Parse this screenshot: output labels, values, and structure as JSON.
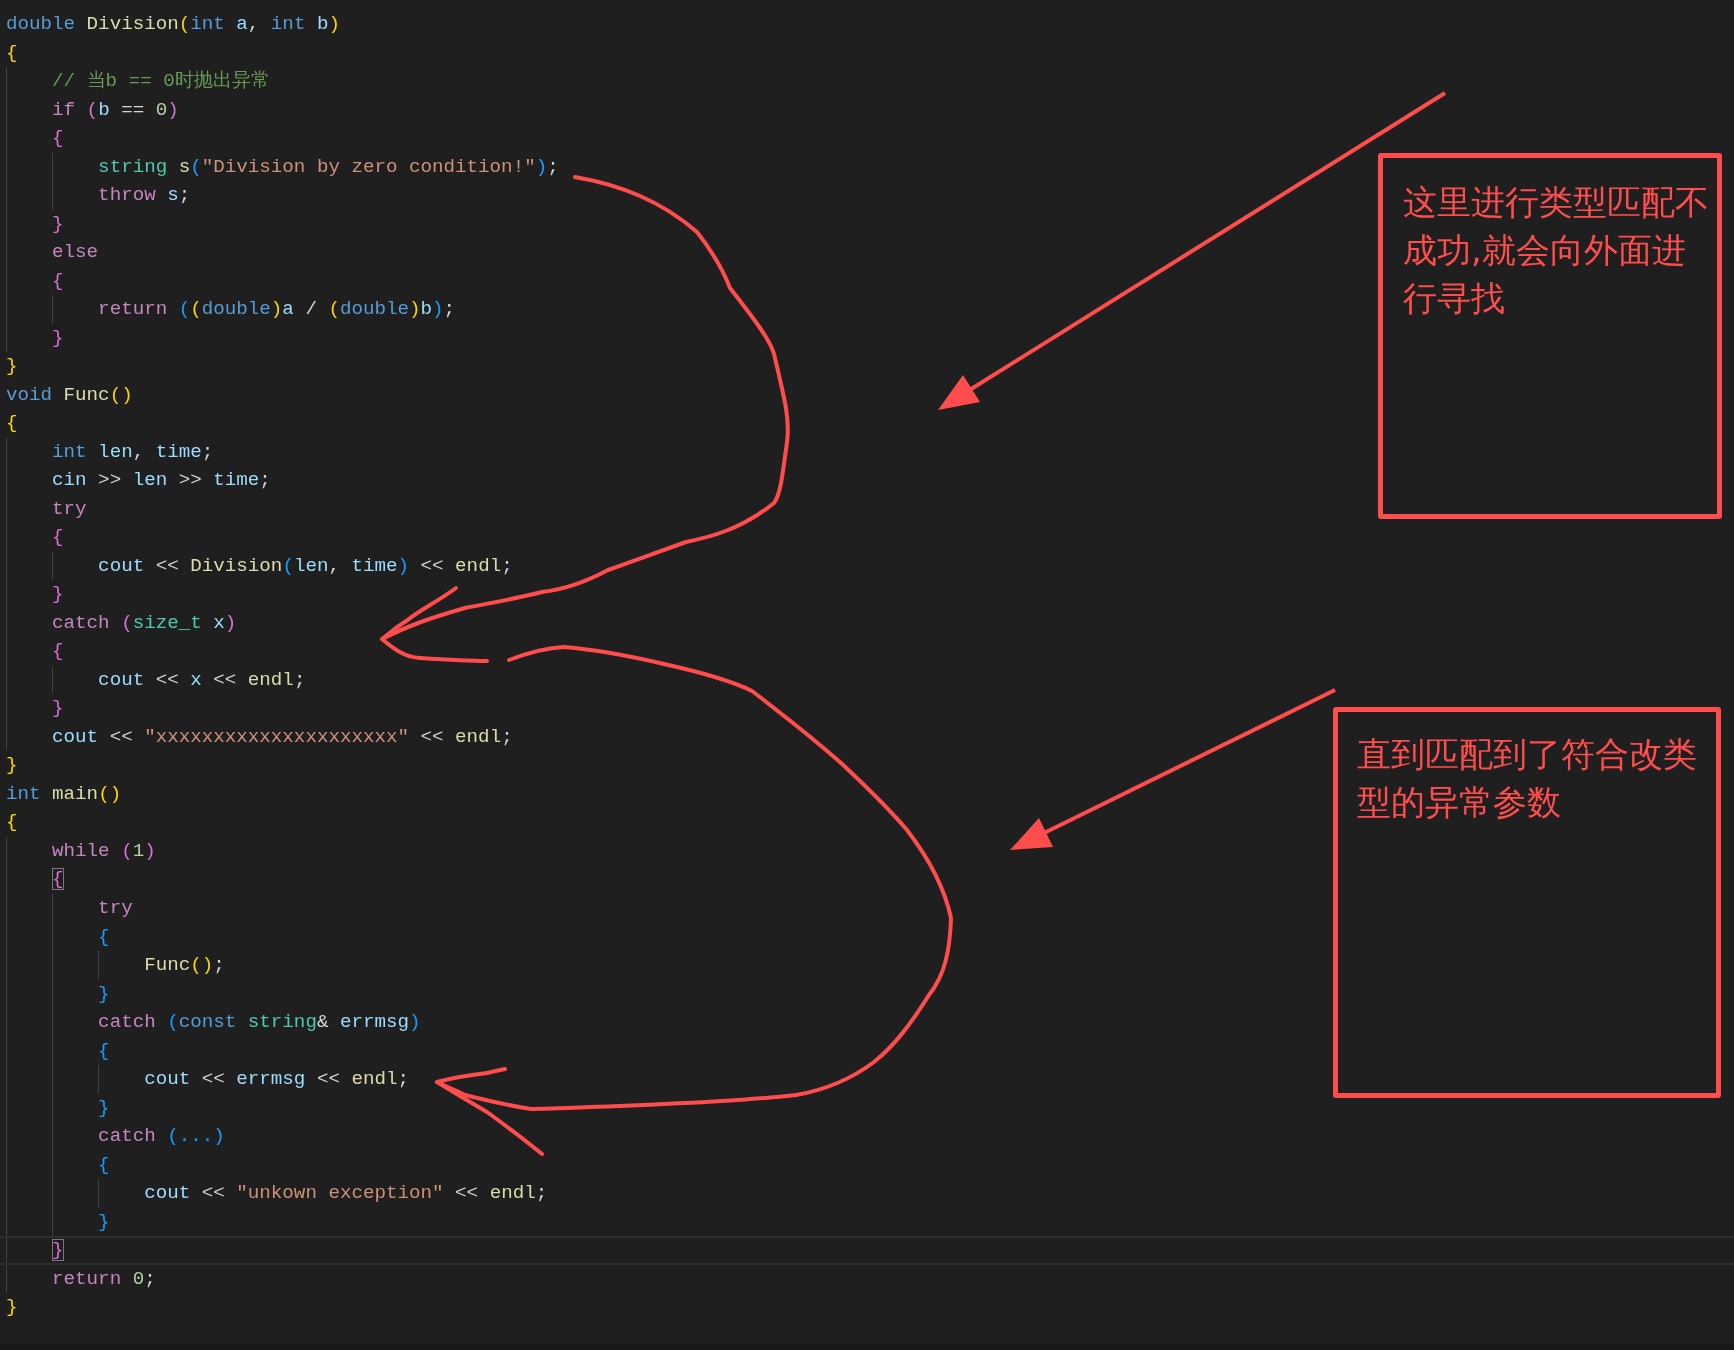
{
  "editor": {
    "lines": [
      {
        "current": false,
        "bracket_match": false,
        "tokens": [
          {
            "text": "double ",
            "kind": "keyword"
          },
          {
            "text": "Division",
            "kind": "function"
          },
          {
            "text": "(",
            "kind": "bracket1"
          },
          {
            "text": "int",
            "kind": "keyword"
          },
          {
            "text": " a",
            "kind": "variable"
          },
          {
            "text": ", ",
            "kind": "plain"
          },
          {
            "text": "int",
            "kind": "keyword"
          },
          {
            "text": " b",
            "kind": "variable"
          },
          {
            "text": ")",
            "kind": "bracket1"
          }
        ]
      },
      {
        "current": false,
        "bracket_match": false,
        "tokens": [
          {
            "text": "{",
            "kind": "bracket1"
          }
        ]
      },
      {
        "current": false,
        "bracket_match": false,
        "tokens": [
          {
            "text": "    // 当b == 0时抛出异常",
            "kind": "comment"
          }
        ]
      },
      {
        "current": false,
        "bracket_match": false,
        "tokens": [
          {
            "text": "    if ",
            "kind": "control"
          },
          {
            "text": "(",
            "kind": "bracket2"
          },
          {
            "text": "b",
            "kind": "variable"
          },
          {
            "text": " == ",
            "kind": "plain"
          },
          {
            "text": "0",
            "kind": "number"
          },
          {
            "text": ")",
            "kind": "bracket2"
          }
        ]
      },
      {
        "current": false,
        "bracket_match": false,
        "tokens": [
          {
            "text": "    {",
            "kind": "bracket2"
          }
        ]
      },
      {
        "current": false,
        "bracket_match": false,
        "tokens": [
          {
            "text": "        string ",
            "kind": "type"
          },
          {
            "text": "s",
            "kind": "function"
          },
          {
            "text": "(",
            "kind": "bracket3"
          },
          {
            "text": "\"Division by zero condition!\"",
            "kind": "string"
          },
          {
            "text": ")",
            "kind": "bracket3"
          },
          {
            "text": ";",
            "kind": "plain"
          }
        ]
      },
      {
        "current": false,
        "bracket_match": false,
        "tokens": [
          {
            "text": "        throw",
            "kind": "control"
          },
          {
            "text": " s",
            "kind": "variable"
          },
          {
            "text": ";",
            "kind": "plain"
          }
        ]
      },
      {
        "current": false,
        "bracket_match": false,
        "tokens": [
          {
            "text": "    }",
            "kind": "bracket2"
          }
        ]
      },
      {
        "current": false,
        "bracket_match": false,
        "tokens": [
          {
            "text": "    else",
            "kind": "control"
          }
        ]
      },
      {
        "current": false,
        "bracket_match": false,
        "tokens": [
          {
            "text": "    {",
            "kind": "bracket2"
          }
        ]
      },
      {
        "current": false,
        "bracket_match": false,
        "tokens": [
          {
            "text": "        return ",
            "kind": "control"
          },
          {
            "text": "(",
            "kind": "bracket3"
          },
          {
            "text": "(",
            "kind": "bracket1"
          },
          {
            "text": "double",
            "kind": "keyword"
          },
          {
            "text": ")",
            "kind": "bracket1"
          },
          {
            "text": "a",
            "kind": "variable"
          },
          {
            "text": " / ",
            "kind": "plain"
          },
          {
            "text": "(",
            "kind": "bracket1"
          },
          {
            "text": "double",
            "kind": "keyword"
          },
          {
            "text": ")",
            "kind": "bracket1"
          },
          {
            "text": "b",
            "kind": "variable"
          },
          {
            "text": ")",
            "kind": "bracket3"
          },
          {
            "text": ";",
            "kind": "plain"
          }
        ]
      },
      {
        "current": false,
        "bracket_match": false,
        "tokens": [
          {
            "text": "    }",
            "kind": "bracket2"
          }
        ]
      },
      {
        "current": false,
        "bracket_match": false,
        "tokens": [
          {
            "text": "}",
            "kind": "bracket1"
          }
        ]
      },
      {
        "current": false,
        "bracket_match": false,
        "tokens": [
          {
            "text": "void ",
            "kind": "keyword"
          },
          {
            "text": "Func",
            "kind": "function"
          },
          {
            "text": "()",
            "kind": "bracket1"
          }
        ]
      },
      {
        "current": false,
        "bracket_match": false,
        "tokens": [
          {
            "text": "{",
            "kind": "bracket1"
          }
        ]
      },
      {
        "current": false,
        "bracket_match": false,
        "tokens": [
          {
            "text": "    int",
            "kind": "keyword"
          },
          {
            "text": " len",
            "kind": "variable"
          },
          {
            "text": ", ",
            "kind": "plain"
          },
          {
            "text": "time",
            "kind": "variable"
          },
          {
            "text": ";",
            "kind": "plain"
          }
        ]
      },
      {
        "current": false,
        "bracket_match": false,
        "tokens": [
          {
            "text": "    cin",
            "kind": "variable"
          },
          {
            "text": " >> ",
            "kind": "plain"
          },
          {
            "text": "len",
            "kind": "variable"
          },
          {
            "text": " >> ",
            "kind": "plain"
          },
          {
            "text": "time",
            "kind": "variable"
          },
          {
            "text": ";",
            "kind": "plain"
          }
        ]
      },
      {
        "current": false,
        "bracket_match": false,
        "tokens": [
          {
            "text": "    try",
            "kind": "control"
          }
        ]
      },
      {
        "current": false,
        "bracket_match": false,
        "tokens": [
          {
            "text": "    {",
            "kind": "bracket2"
          }
        ]
      },
      {
        "current": false,
        "bracket_match": false,
        "tokens": [
          {
            "text": "        cout",
            "kind": "variable"
          },
          {
            "text": " << ",
            "kind": "plain"
          },
          {
            "text": "Division",
            "kind": "function"
          },
          {
            "text": "(",
            "kind": "bracket3"
          },
          {
            "text": "len",
            "kind": "variable"
          },
          {
            "text": ", ",
            "kind": "plain"
          },
          {
            "text": "time",
            "kind": "variable"
          },
          {
            "text": ")",
            "kind": "bracket3"
          },
          {
            "text": " << ",
            "kind": "plain"
          },
          {
            "text": "endl",
            "kind": "function"
          },
          {
            "text": ";",
            "kind": "plain"
          }
        ]
      },
      {
        "current": false,
        "bracket_match": false,
        "tokens": [
          {
            "text": "    }",
            "kind": "bracket2"
          }
        ]
      },
      {
        "current": false,
        "bracket_match": false,
        "tokens": [
          {
            "text": "    catch ",
            "kind": "control"
          },
          {
            "text": "(",
            "kind": "bracket2"
          },
          {
            "text": "size_t",
            "kind": "type"
          },
          {
            "text": " x",
            "kind": "variable"
          },
          {
            "text": ")",
            "kind": "bracket2"
          }
        ]
      },
      {
        "current": false,
        "bracket_match": false,
        "tokens": [
          {
            "text": "    {",
            "kind": "bracket2"
          }
        ]
      },
      {
        "current": false,
        "bracket_match": false,
        "tokens": [
          {
            "text": "        cout",
            "kind": "variable"
          },
          {
            "text": " << ",
            "kind": "plain"
          },
          {
            "text": "x",
            "kind": "variable"
          },
          {
            "text": " << ",
            "kind": "plain"
          },
          {
            "text": "endl",
            "kind": "function"
          },
          {
            "text": ";",
            "kind": "plain"
          }
        ]
      },
      {
        "current": false,
        "bracket_match": false,
        "tokens": [
          {
            "text": "    }",
            "kind": "bracket2"
          }
        ]
      },
      {
        "current": false,
        "bracket_match": false,
        "tokens": [
          {
            "text": "    cout",
            "kind": "variable"
          },
          {
            "text": " << ",
            "kind": "plain"
          },
          {
            "text": "\"xxxxxxxxxxxxxxxxxxxxx\"",
            "kind": "string"
          },
          {
            "text": " << ",
            "kind": "plain"
          },
          {
            "text": "endl",
            "kind": "function"
          },
          {
            "text": ";",
            "kind": "plain"
          }
        ]
      },
      {
        "current": false,
        "bracket_match": false,
        "tokens": [
          {
            "text": "}",
            "kind": "bracket1"
          }
        ]
      },
      {
        "current": false,
        "bracket_match": false,
        "tokens": [
          {
            "text": "int ",
            "kind": "keyword"
          },
          {
            "text": "main",
            "kind": "function"
          },
          {
            "text": "()",
            "kind": "bracket1"
          }
        ]
      },
      {
        "current": false,
        "bracket_match": false,
        "tokens": [
          {
            "text": "{",
            "kind": "bracket1"
          }
        ]
      },
      {
        "current": false,
        "bracket_match": false,
        "tokens": [
          {
            "text": "    while ",
            "kind": "control"
          },
          {
            "text": "(",
            "kind": "bracket2"
          },
          {
            "text": "1",
            "kind": "number"
          },
          {
            "text": ")",
            "kind": "bracket2"
          }
        ]
      },
      {
        "current": false,
        "bracket_match": true,
        "tokens": [
          {
            "text": "    {",
            "kind": "bracket2"
          }
        ]
      },
      {
        "current": false,
        "bracket_match": false,
        "tokens": [
          {
            "text": "        try",
            "kind": "control"
          }
        ]
      },
      {
        "current": false,
        "bracket_match": false,
        "tokens": [
          {
            "text": "        {",
            "kind": "bracket3"
          }
        ]
      },
      {
        "current": false,
        "bracket_match": false,
        "tokens": [
          {
            "text": "            Func",
            "kind": "function"
          },
          {
            "text": "()",
            "kind": "bracket1"
          },
          {
            "text": ";",
            "kind": "plain"
          }
        ]
      },
      {
        "current": false,
        "bracket_match": false,
        "tokens": [
          {
            "text": "        }",
            "kind": "bracket3"
          }
        ]
      },
      {
        "current": false,
        "bracket_match": false,
        "tokens": [
          {
            "text": "        catch ",
            "kind": "control"
          },
          {
            "text": "(",
            "kind": "bracket3"
          },
          {
            "text": "const ",
            "kind": "keyword"
          },
          {
            "text": "string",
            "kind": "type"
          },
          {
            "text": "& ",
            "kind": "plain"
          },
          {
            "text": "errmsg",
            "kind": "variable"
          },
          {
            "text": ")",
            "kind": "bracket3"
          }
        ]
      },
      {
        "current": false,
        "bracket_match": false,
        "tokens": [
          {
            "text": "        {",
            "kind": "bracket3"
          }
        ]
      },
      {
        "current": false,
        "bracket_match": false,
        "tokens": [
          {
            "text": "            cout",
            "kind": "variable"
          },
          {
            "text": " << ",
            "kind": "plain"
          },
          {
            "text": "errmsg",
            "kind": "variable"
          },
          {
            "text": " << ",
            "kind": "plain"
          },
          {
            "text": "endl",
            "kind": "function"
          },
          {
            "text": ";",
            "kind": "plain"
          }
        ]
      },
      {
        "current": false,
        "bracket_match": false,
        "tokens": [
          {
            "text": "        }",
            "kind": "bracket3"
          }
        ]
      },
      {
        "current": false,
        "bracket_match": false,
        "tokens": [
          {
            "text": "        catch ",
            "kind": "control"
          },
          {
            "text": "(...)",
            "kind": "bracket3"
          }
        ]
      },
      {
        "current": false,
        "bracket_match": false,
        "tokens": [
          {
            "text": "        {",
            "kind": "bracket3"
          }
        ]
      },
      {
        "current": false,
        "bracket_match": false,
        "tokens": [
          {
            "text": "            cout",
            "kind": "variable"
          },
          {
            "text": " << ",
            "kind": "plain"
          },
          {
            "text": "\"unkown exception\"",
            "kind": "string"
          },
          {
            "text": " << ",
            "kind": "plain"
          },
          {
            "text": "endl",
            "kind": "function"
          },
          {
            "text": ";",
            "kind": "plain"
          }
        ]
      },
      {
        "current": false,
        "bracket_match": false,
        "tokens": [
          {
            "text": "        }",
            "kind": "bracket3"
          }
        ]
      },
      {
        "current": true,
        "bracket_match": true,
        "tokens": [
          {
            "text": "    }",
            "kind": "bracket2"
          }
        ]
      },
      {
        "current": false,
        "bracket_match": false,
        "tokens": [
          {
            "text": "    return ",
            "kind": "control"
          },
          {
            "text": "0",
            "kind": "number"
          },
          {
            "text": ";",
            "kind": "plain"
          }
        ]
      },
      {
        "current": false,
        "bracket_match": false,
        "tokens": [
          {
            "text": "}",
            "kind": "bracket1"
          }
        ]
      }
    ]
  },
  "annotations": [
    {
      "text": "这里进行类型匹配不成功,就会向外面进行寻找"
    },
    {
      "text": "直到匹配到了符合改类型的异常参数"
    }
  ]
}
